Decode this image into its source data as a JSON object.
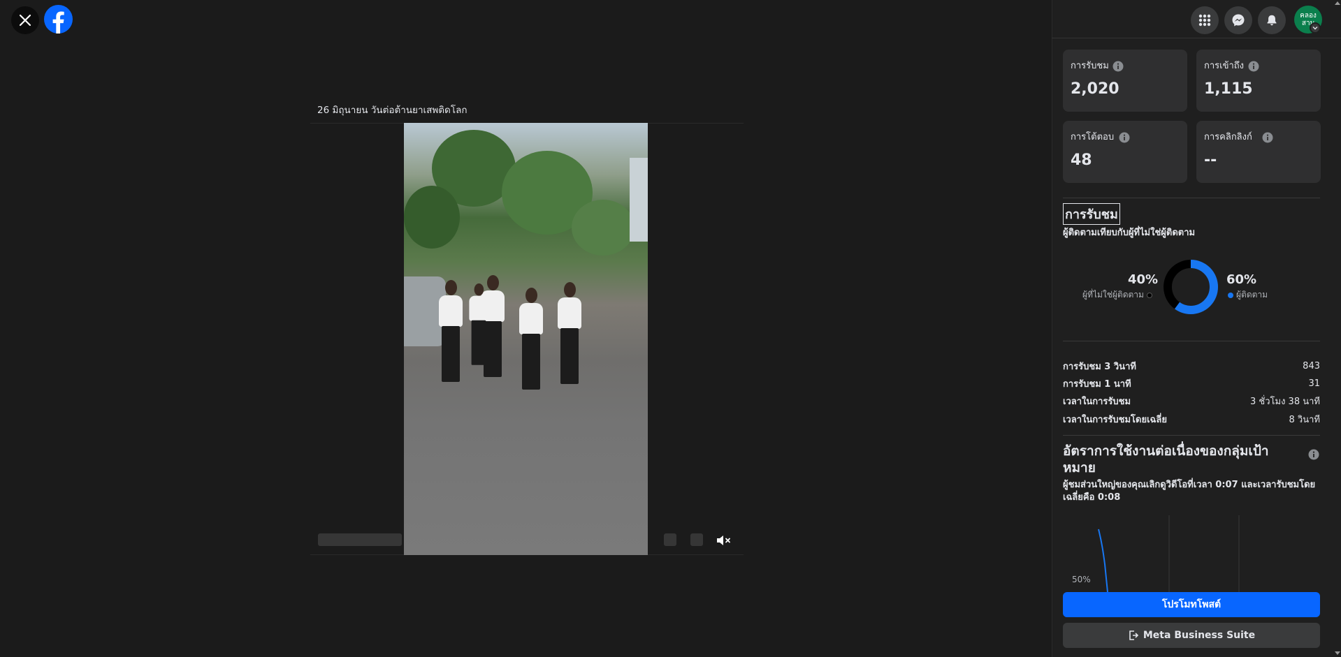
{
  "post": {
    "caption": "26 มิถุนายน วันต่อต้านยาเสพติดโลก"
  },
  "header": {
    "avatar_text_line1": "คลอง",
    "avatar_text_line2": "สาม"
  },
  "stats": [
    {
      "label": "การรับชม",
      "value": "2,020"
    },
    {
      "label": "การเข้าถึง",
      "value": "1,115"
    },
    {
      "label": "การโต้ตอบ",
      "value": "48"
    },
    {
      "label": "การคลิกลิงก์",
      "value": "--"
    }
  ],
  "views": {
    "title": "การรับชม",
    "subtitle": "ผู้ติดตามเทียบกับผู้ที่ไม่ใช่ผู้ติดตาม",
    "non_followers_pct": "40%",
    "non_followers_label": "ผู้ที่ไม่ใช่ผู้ติดตาม",
    "followers_pct": "60%",
    "followers_label": "ผู้ติดตาม"
  },
  "chart_data": {
    "type": "pie",
    "categories": [
      "ผู้ที่ไม่ใช่ผู้ติดตาม",
      "ผู้ติดตาม"
    ],
    "values": [
      40,
      60
    ],
    "colors": [
      "#000000",
      "#1877f2"
    ]
  },
  "metrics": [
    {
      "key": "การรับชม 3 วินาที",
      "value": "843"
    },
    {
      "key": "การรับชม 1 นาที",
      "value": "31"
    },
    {
      "key": "เวลาในการรับชม",
      "value": "3 ชั่วโมง 38 นาที"
    },
    {
      "key": "เวลาในการรับชมโดยเฉลี่ย",
      "value": "8 วินาที"
    }
  ],
  "retention": {
    "title": "อัตราการใช้งานต่อเนื่องของกลุ่มเป้าหมาย",
    "subtitle": "ผู้ชมส่วนใหญ่ของคุณเลิกดูวิดีโอที่เวลา 0:07 และเวลารับชมโดยเฉลี่ยคือ 0:08",
    "y_tick": "50%"
  },
  "buttons": {
    "promote": "โปรโมทโพสต์",
    "business_suite": "Meta Business Suite"
  },
  "colors": {
    "accent": "#0866ff",
    "panel_bg": "#1f1f1f",
    "card_bg": "#2f2f30"
  }
}
